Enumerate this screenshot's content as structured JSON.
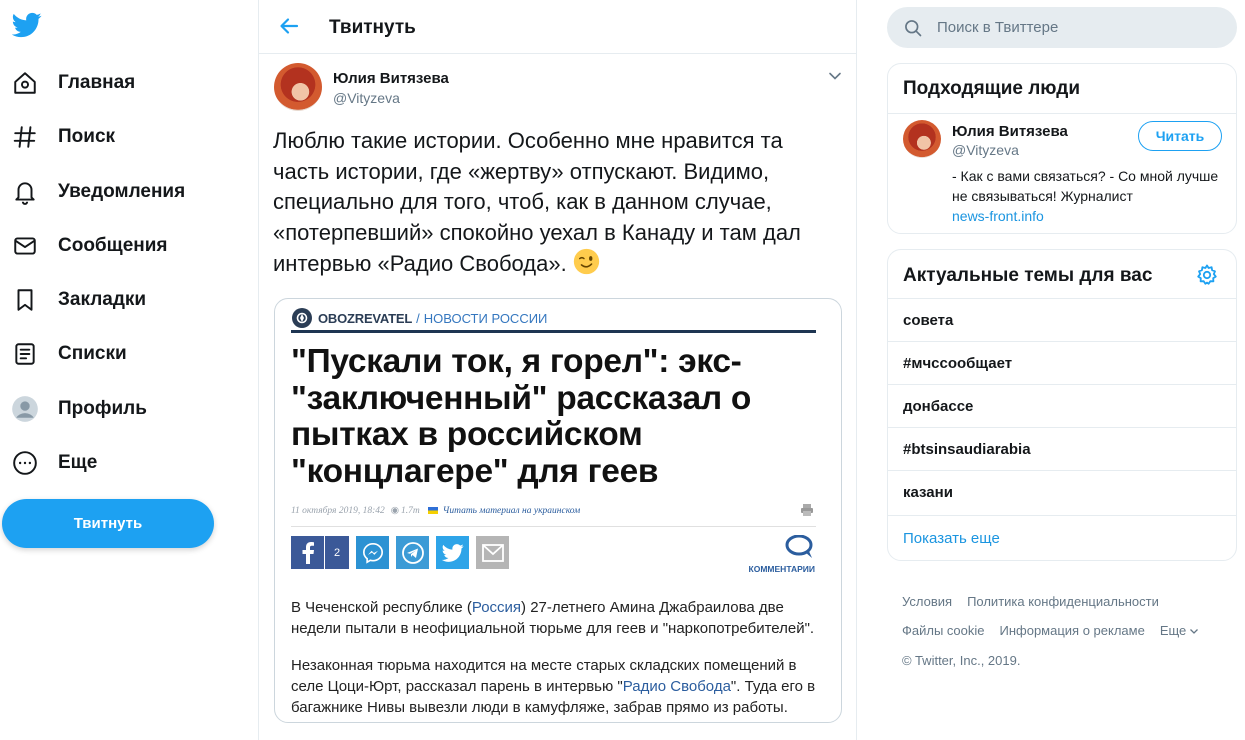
{
  "nav": {
    "items": [
      {
        "label": "Главная",
        "icon": "home-icon"
      },
      {
        "label": "Поиск",
        "icon": "hashtag-icon"
      },
      {
        "label": "Уведомления",
        "icon": "bell-icon"
      },
      {
        "label": "Сообщения",
        "icon": "envelope-icon"
      },
      {
        "label": "Закладки",
        "icon": "bookmark-icon"
      },
      {
        "label": "Списки",
        "icon": "list-icon"
      },
      {
        "label": "Профиль",
        "icon": "profile-icon"
      },
      {
        "label": "Еще",
        "icon": "more-icon"
      }
    ],
    "tweet_button": "Твитнуть"
  },
  "header": {
    "title": "Твитнуть"
  },
  "tweet": {
    "author_name": "Юлия Витязева",
    "author_handle": "@Vityzeva",
    "text": "Люблю такие истории. Особенно мне нравится та часть истории, где «жертву» отпускают. Видимо, специально для того, чтоб, как в данном случае, «потерпевший» спокойно уехал в Канаду и там дал интервью «Радио Свобода».",
    "emoji": "winking-face"
  },
  "card": {
    "brand": "OBOZREVATEL",
    "separator": "/",
    "section": "НОВОСТИ РОССИИ",
    "headline": "\"Пускали ток, я горел\": экс-\"заключенный\" рассказал о пытках в российском \"концлагере\" для геев",
    "meta_date": "11 октября 2019, 18:42",
    "meta_views": "1.7т",
    "meta_read": "Читать материал на украинском",
    "fb_count": "2",
    "comments_label": "КОММЕНТАРИИ",
    "para1_pre": "В Чеченской республике (",
    "para1_link": "Россия",
    "para1_post": ") 27-летнего Амина Джабраилова две недели пытали в неофициальной тюрьме для геев и \"наркопотребителей\".",
    "para2_pre": "Незаконная тюрьма находится на месте старых складских помещений в селе Цоци-Юрт, рассказал парень в интервью \"",
    "para2_link": "Радио Свобода",
    "para2_post": "\". Туда его в багажнике Нивы вывезли люди в камуфляже, забрав прямо из работы."
  },
  "search": {
    "placeholder": "Поиск в Твиттере"
  },
  "suggested": {
    "title": "Подходящие люди",
    "name": "Юлия Витязева",
    "handle": "@Vityzeva",
    "follow_label": "Читать",
    "bio": "- Как с вами связаться? - Со мной лучше не связываться! Журналист",
    "bio_link": "news-front.info"
  },
  "trends": {
    "title": "Актуальные темы для вас",
    "items": [
      "совета",
      "#мчссообщает",
      "донбассе",
      "#btsinsaudiarabia",
      "казани"
    ],
    "show_more": "Показать еще"
  },
  "footer": {
    "terms": "Условия",
    "privacy": "Политика конфиденциальности",
    "cookies": "Файлы cookie",
    "ads": "Информация о рекламе",
    "more": "Еще",
    "copyright": "© Twitter, Inc., 2019."
  },
  "colors": {
    "accent": "#1da1f2",
    "link": "#1b95e0",
    "border": "#e6ecf0",
    "muted": "#657786"
  }
}
